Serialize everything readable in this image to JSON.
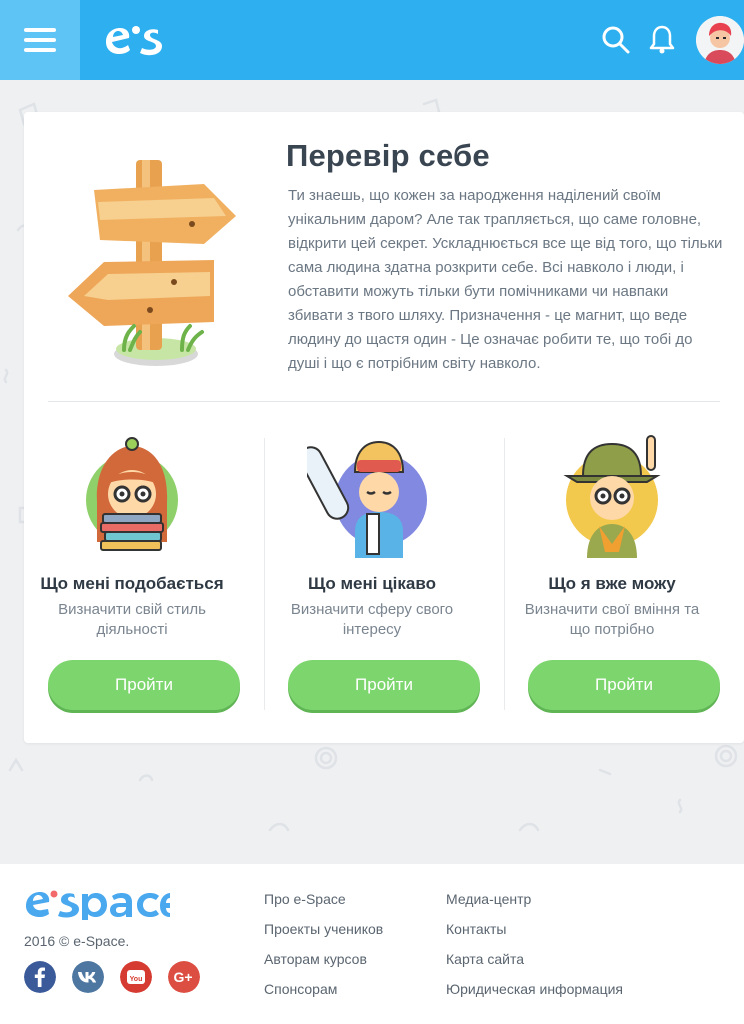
{
  "header": {
    "menu_icon": "hamburger-menu-icon",
    "logo_icon": "e-space-logo",
    "search_icon": "search-icon",
    "notification_icon": "bell-icon",
    "avatar_icon": "user-avatar"
  },
  "colors": {
    "header_bg": "#2eb0f0",
    "button_green": "#7dd56e",
    "footer_logo_blue": "#4aa8ef"
  },
  "intro": {
    "title": "Перевір себе",
    "text": "Ти знаешь, що кожен за народження наділений своїм унікальним даром? Але так трапляється, що саме головне, відкрити цей секрет. Ускладнюється все ще від того, що тільки сама людина здатна розкрити себе. Всі навколо і люди, і обставити можуть тільки бути помічниками чи навпаки збивати з твого шляху. Призначення - це магнит, що веде людину до щастя один - Це означає робити те, що тобі до душі і що є потрібним світу навколо."
  },
  "tests": [
    {
      "title": "Що мені подобається",
      "subtitle": "Визначити свій стиль діяльності",
      "button": "Пройти"
    },
    {
      "title": "Що мені цікаво",
      "subtitle": "Визначити сферу свого інтересу",
      "button": "Пройти"
    },
    {
      "title": "Що я вже можу",
      "subtitle": "Визначити свої вміння та що потрібно",
      "button": "Пройти"
    }
  ],
  "footer": {
    "copyright": "2016 © e-Space.",
    "social": [
      "facebook-icon",
      "vk-icon",
      "youtube-icon",
      "google-plus-icon"
    ],
    "links_col1": [
      "Про e-Space",
      "Проекты учеников",
      "Авторам курсов",
      "Спонсорам"
    ],
    "links_col2": [
      "Медиа-центр",
      "Контакты",
      "Карта сайта",
      "Юридическая информация"
    ]
  }
}
